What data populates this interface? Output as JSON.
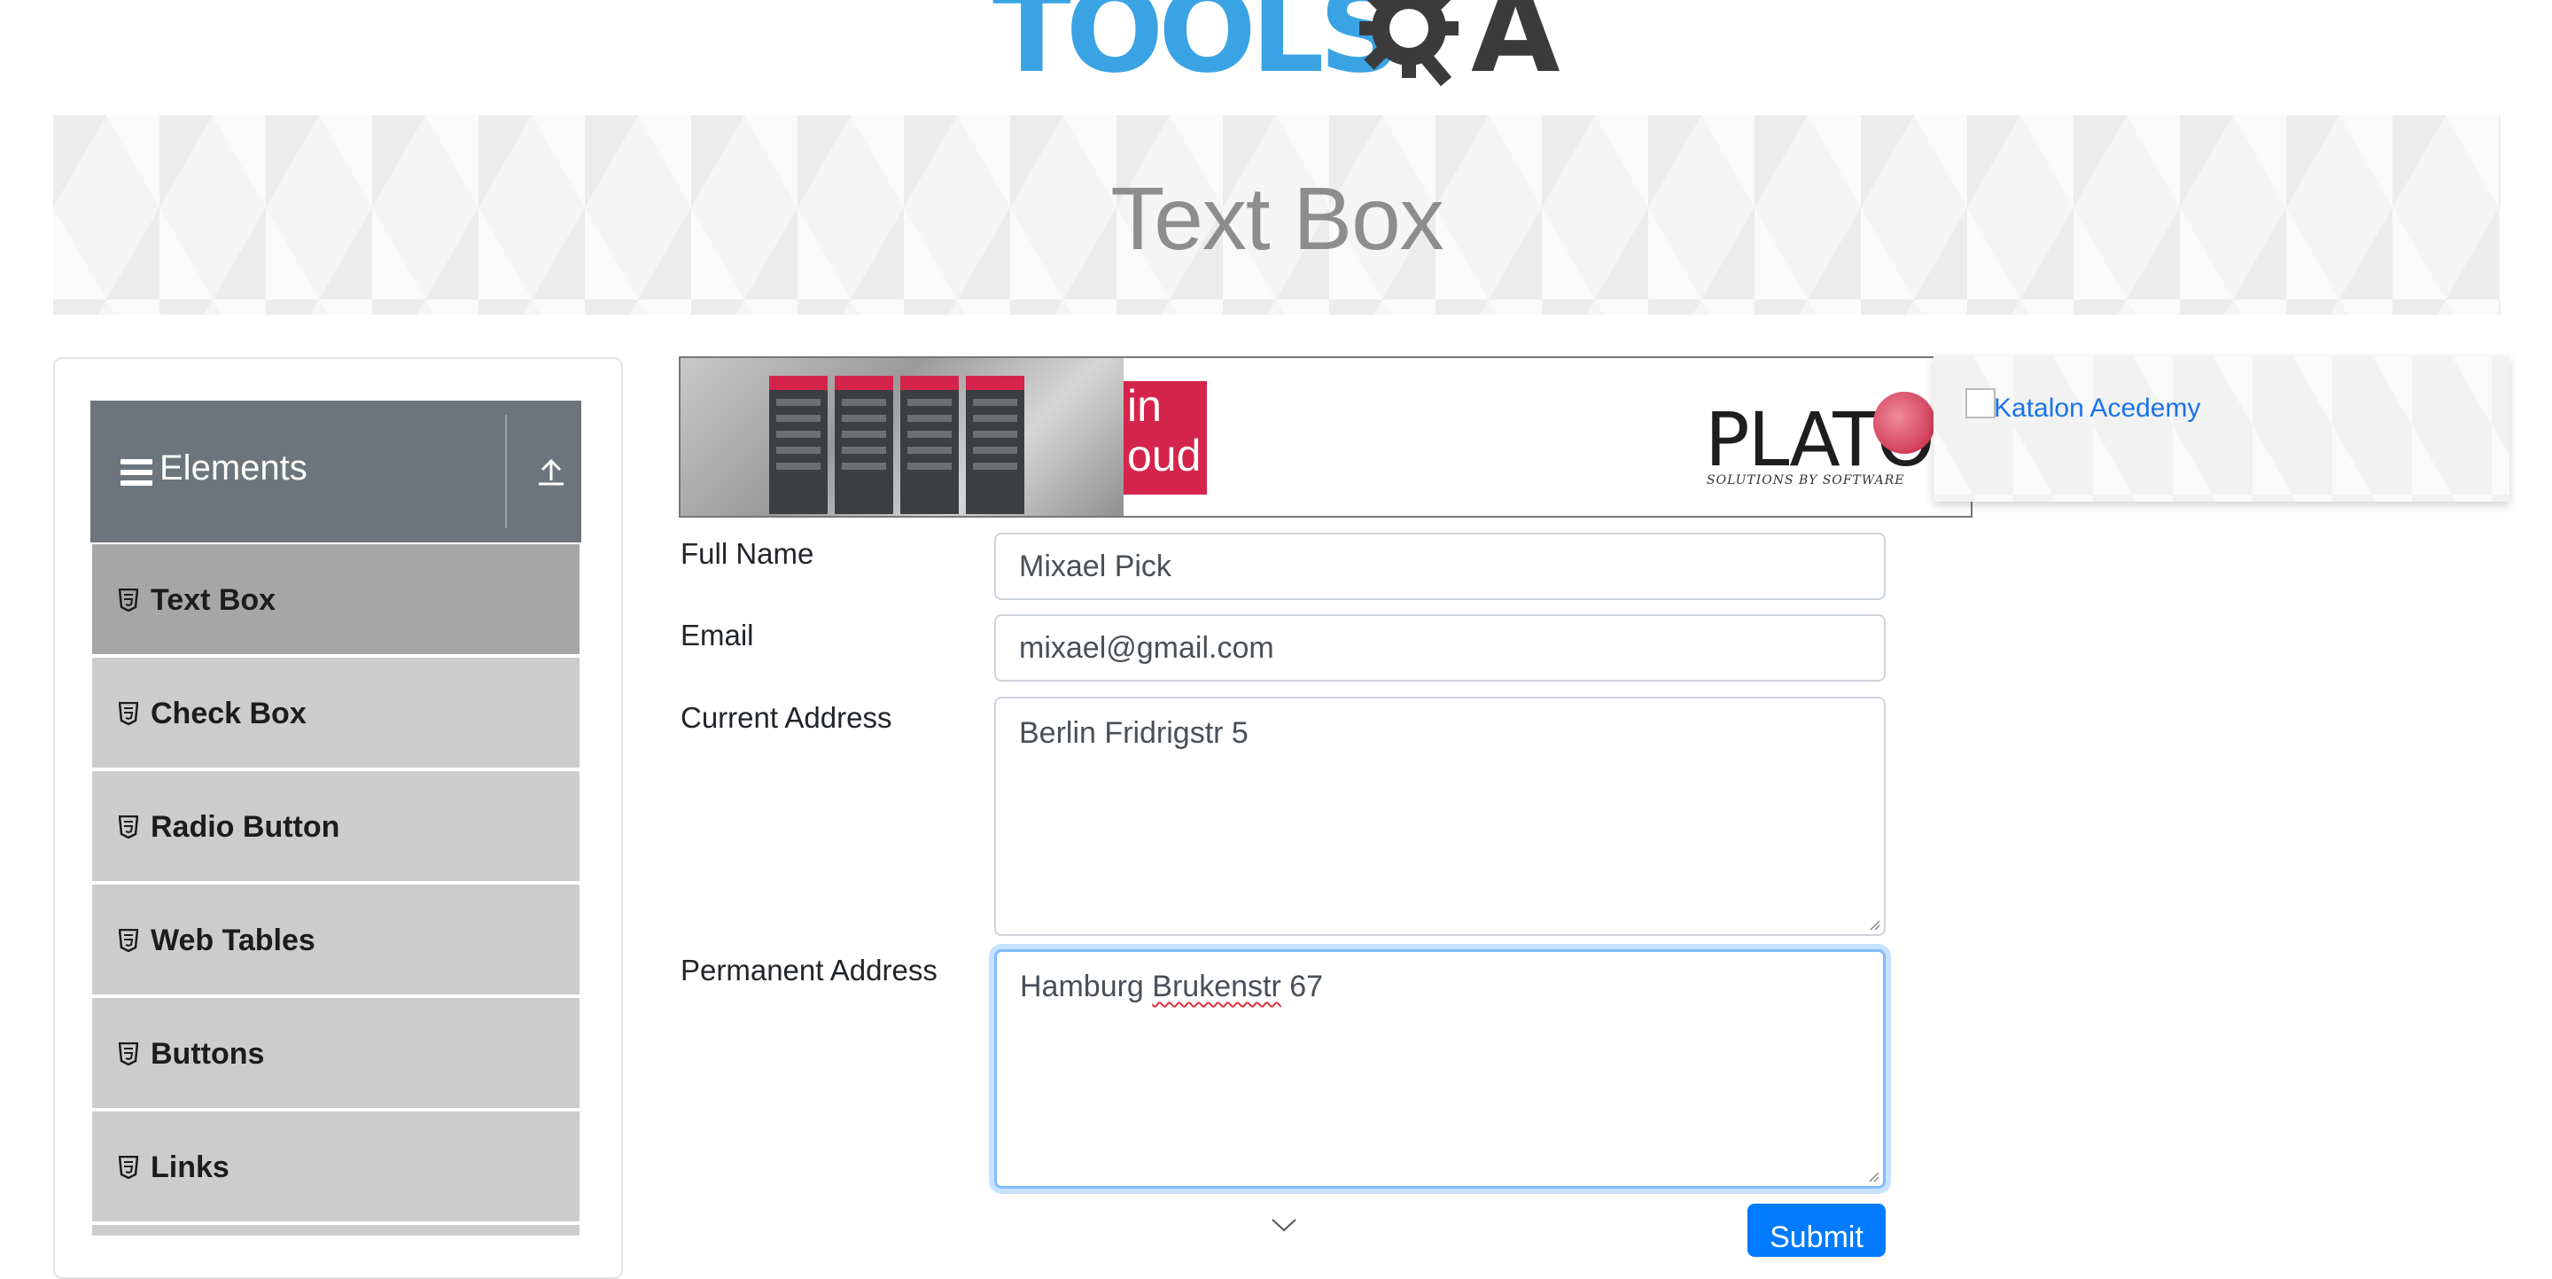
{
  "logo": {
    "text": "TOOLS",
    "suffix": "A"
  },
  "banner": {
    "title": "Text Box"
  },
  "sidebar": {
    "group": {
      "title": "Elements"
    },
    "items": [
      {
        "label": "Text Box",
        "active": true
      },
      {
        "label": "Check Box"
      },
      {
        "label": "Radio Button"
      },
      {
        "label": "Web Tables"
      },
      {
        "label": "Buttons"
      },
      {
        "label": "Links"
      }
    ]
  },
  "ads": {
    "left": {
      "brand": "PLATO",
      "tagline": "SOLUTIONS BY SOFTWARE",
      "cta_partial": "in\noud"
    },
    "right": {
      "link_text": "Katalon Acedemy"
    }
  },
  "form": {
    "full_name": {
      "label": "Full Name",
      "value": "Mixael Pick"
    },
    "email": {
      "label": "Email",
      "value": "mixael@gmail.com"
    },
    "current_address": {
      "label": "Current Address",
      "value": "Berlin Fridrigstr 5"
    },
    "permanent_address": {
      "label": "Permanent Address",
      "value_a": "Hamburg ",
      "value_b": "Brukenstr",
      "value_c": " 67"
    },
    "submit_label": "Submit"
  },
  "colors": {
    "primary": "#007bff",
    "sidebar_header": "#6c757d",
    "menu_item": "#cccccc",
    "menu_active": "#a6a6a6",
    "logo_blue": "#3aa3e3"
  }
}
